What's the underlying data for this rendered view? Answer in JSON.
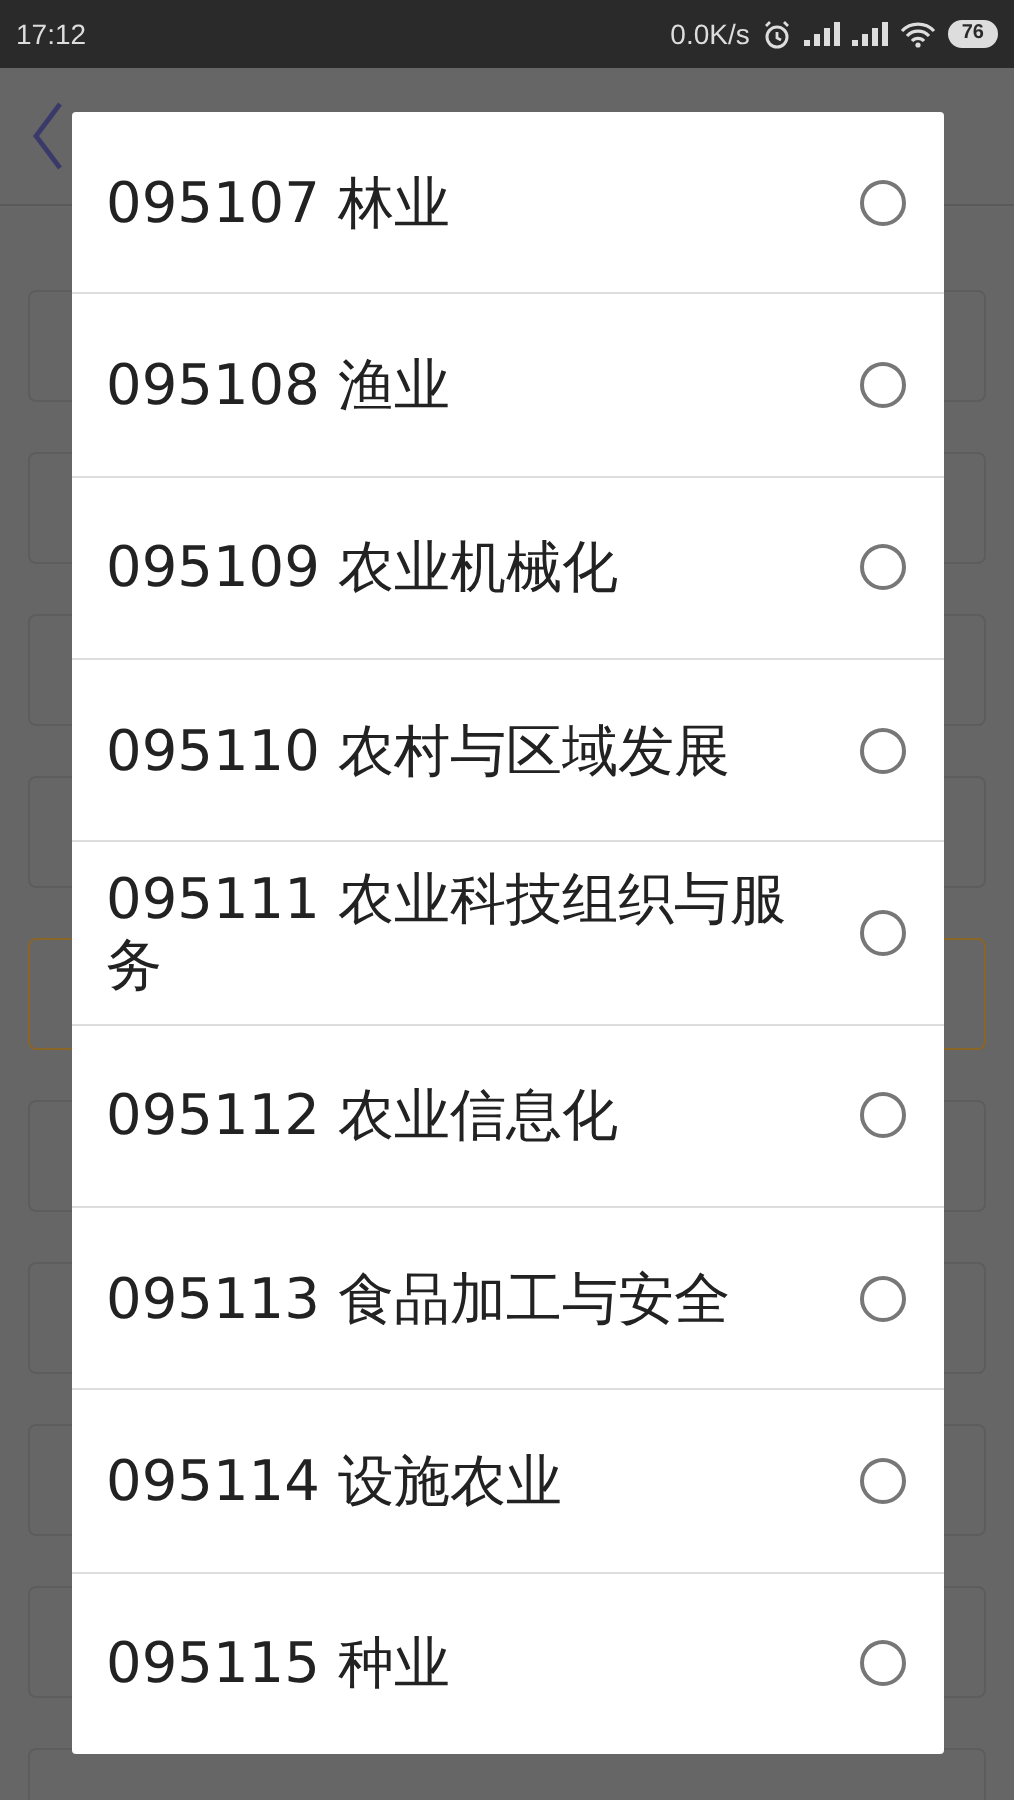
{
  "status_bar": {
    "time": "17:12",
    "net_speed": "0.0K/s",
    "battery": "76"
  },
  "background_fields": [
    {
      "highlighted": false
    },
    {
      "highlighted": false
    },
    {
      "highlighted": false
    },
    {
      "highlighted": false
    },
    {
      "highlighted": true
    },
    {
      "highlighted": false
    },
    {
      "highlighted": false
    },
    {
      "highlighted": false
    },
    {
      "highlighted": false
    },
    {
      "highlighted": false
    }
  ],
  "dialog": {
    "options": [
      {
        "label": "095107 林业",
        "selected": false
      },
      {
        "label": "095108 渔业",
        "selected": false
      },
      {
        "label": "095109 农业机械化",
        "selected": false
      },
      {
        "label": "095110 农村与区域发展",
        "selected": false
      },
      {
        "label": "095111 农业科技组织与服务",
        "selected": false
      },
      {
        "label": "095112 农业信息化",
        "selected": false
      },
      {
        "label": "095113 食品加工与安全",
        "selected": false
      },
      {
        "label": "095114 设施农业",
        "selected": false
      },
      {
        "label": "095115 种业",
        "selected": false
      }
    ]
  }
}
